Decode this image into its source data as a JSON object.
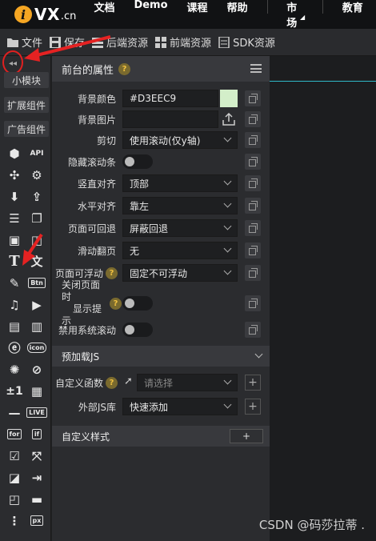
{
  "logo": {
    "mark": "i",
    "name": "VX",
    "suffix": ".cn"
  },
  "nav": {
    "items": [
      "文档",
      "Demo",
      "课程",
      "帮助"
    ],
    "market": "市场",
    "edu": "教育"
  },
  "toolbar": {
    "file": "文件",
    "save": "保存",
    "backend": "后端资源",
    "frontend": "前端资源",
    "sdk": "SDK资源"
  },
  "sidebar": {
    "small_module": "小模块",
    "extend": "扩展组件",
    "ad": "广告组件",
    "icons": [
      "cube-icon",
      "api-label",
      "graph-icon",
      "gear-icon",
      "download-icon",
      "upload-file-icon",
      "list-icon",
      "copy-icon",
      "image-icon",
      "image-edit-icon",
      "text-icon",
      "translate-icon",
      "edit-icon",
      "button-label",
      "music-icon",
      "video-icon",
      "doc-icon",
      "doc-lines-icon",
      "ie-icon",
      "icon-label",
      "shutter-icon",
      "compass-icon",
      "plus-minus-icon",
      "qrcode-icon",
      "divider-icon",
      "live-label",
      "for-label",
      "if-label",
      "list-check-icon",
      "expand-icon",
      "note-icon",
      "arrow-box-icon",
      "layer-icon",
      "progress-icon",
      "slider-icon",
      "px-label"
    ],
    "labels": {
      "api": "API",
      "btn": "Btn",
      "icon": "icon",
      "live": "LIVE",
      "for": "for",
      "if": "if",
      "px": "px",
      "pm": "±1"
    }
  },
  "panel": {
    "title": "前台的属性",
    "rows": {
      "bg_color_label": "背景颜色",
      "bg_color_value": "#D3EEC9",
      "bg_image_label": "背景图片",
      "clip_label": "剪切",
      "clip_value": "使用滚动(仅y轴)",
      "hide_scroll_label": "隐藏滚动条",
      "v_align_label": "竖直对齐",
      "v_align_value": "顶部",
      "h_align_label": "水平对齐",
      "h_align_value": "靠左",
      "back_label": "页面可回退",
      "back_value": "屏蔽回退",
      "slide_label": "滑动翻页",
      "slide_value": "无",
      "float_label": "页面可浮动",
      "float_value": "固定不可浮动",
      "close_tip_label_1": "关闭页面时",
      "close_tip_label_2": "显示提示",
      "disable_scroll_label": "禁用系统滚动"
    },
    "preload_title": "预加载JS",
    "custom_func_label": "自定义函数",
    "custom_func_placeholder": "请选择",
    "external_js_label": "外部JS库",
    "external_js_value": "快速添加",
    "custom_style_title": "自定义样式",
    "custom_style_add": "+"
  },
  "watermark": "CSDN @码莎拉蒂 ."
}
